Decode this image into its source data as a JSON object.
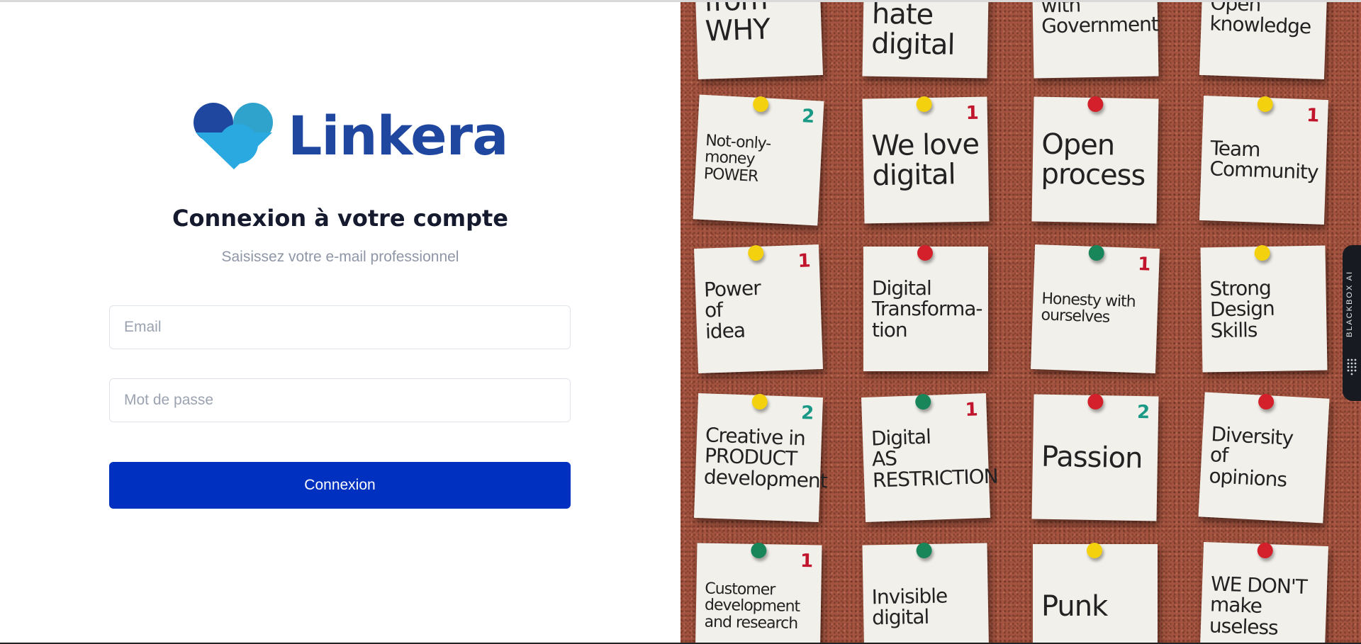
{
  "colors": {
    "brand_dark": "#1f47a0",
    "brand_light": "#29a9e0",
    "button_bg": "#0030c0",
    "title_text": "#151a2e",
    "subtitle_text": "#8e96a6"
  },
  "brand": {
    "name": "Linkera",
    "icon": "heart-logo-icon"
  },
  "login": {
    "title": "Connexion à votre compte",
    "subtitle": "Saisissez votre e-mail professionnel",
    "email_placeholder": "Email",
    "password_placeholder": "Mot de passe",
    "submit_label": "Connexion"
  },
  "side_tab": {
    "label": "BLACKBOX AI",
    "icon": "blackbox-logo-icon"
  },
  "photo": {
    "notes": [
      {
        "text": "from WHY",
        "number": "",
        "pin": ""
      },
      {
        "text": "We hate\ndigital",
        "number": "",
        "pin": ""
      },
      {
        "text": "with\nGovernment",
        "number": "",
        "pin": ""
      },
      {
        "text": "Open\nknowledge",
        "number": "",
        "pin": ""
      },
      {
        "text": "Not-only-money\nPOWER",
        "number": "2",
        "pin": "#f3d10f"
      },
      {
        "text": "We love\ndigital",
        "number": "1",
        "pin": "#f3d10f"
      },
      {
        "text": "Open\nprocess",
        "number": "",
        "pin": "#d4202a"
      },
      {
        "text": "Team\nCommunity",
        "number": "1",
        "pin": "#f3d10f"
      },
      {
        "text": "Power\nof\nidea",
        "number": "1",
        "pin": "#f3d10f"
      },
      {
        "text": "Digital\nTransforma-\ntion",
        "number": "",
        "pin": "#d4202a"
      },
      {
        "text": "Honesty with\nourselves",
        "number": "1",
        "pin": "#19865a"
      },
      {
        "text": "Strong\nDesign\nSkills",
        "number": "",
        "pin": "#f3d10f"
      },
      {
        "text": "Creative in\nPRODUCT\ndevelopment",
        "number": "2",
        "pin": "#f3d10f"
      },
      {
        "text": "Digital\nAS\nRESTRICTION",
        "number": "1",
        "pin": "#19865a"
      },
      {
        "text": "Passion",
        "number": "2",
        "pin": "#d4202a"
      },
      {
        "text": "Diversity\nof\nopinions",
        "number": "",
        "pin": "#d4202a"
      },
      {
        "text": "Customer\ndevelopment\nand research",
        "number": "1",
        "pin": "#19865a"
      },
      {
        "text": "Invisible\ndigital",
        "number": "",
        "pin": "#19865a"
      },
      {
        "text": "Punk",
        "number": "",
        "pin": "#f3d10f"
      },
      {
        "text": "WE DON'T\nmake\nuseless",
        "number": "",
        "pin": "#d4202a"
      }
    ]
  }
}
